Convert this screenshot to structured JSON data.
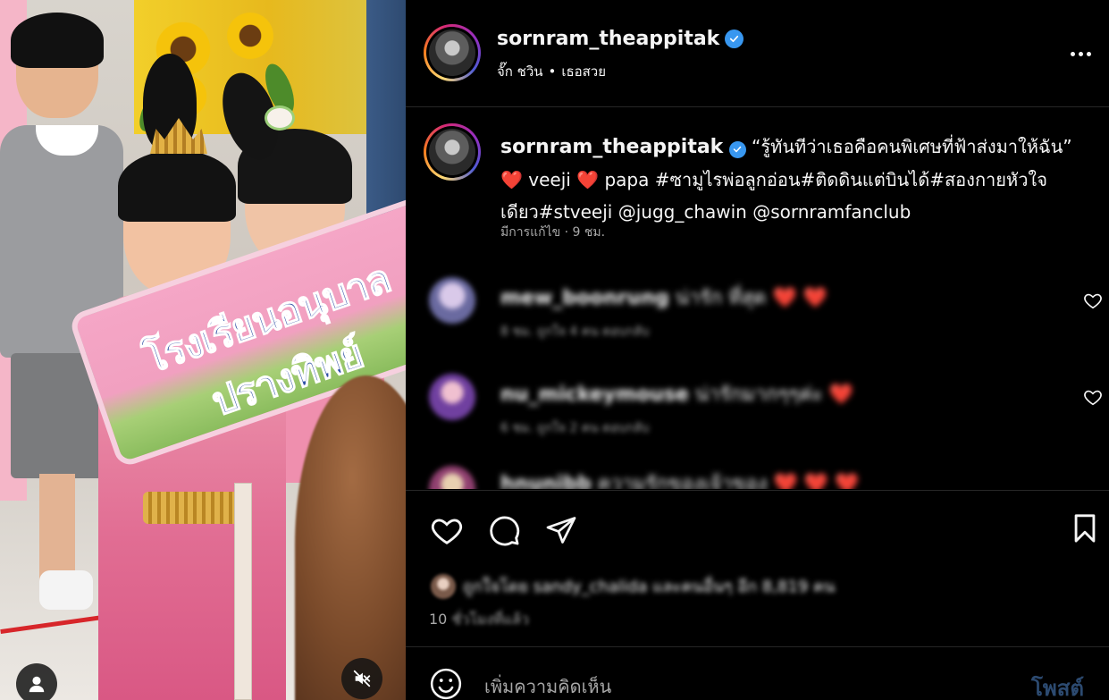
{
  "media": {
    "sign_text": "โรงเรียนอนุบาลปรางทิพย์"
  },
  "post": {
    "username": "sornram_theappitak",
    "audio": {
      "artist": "จั๊ก ชวิน",
      "separator": "•",
      "song": "เธอสวย"
    },
    "caption": {
      "username": "sornram_theappitak",
      "quote": "“รู้ทันทีว่าเธอคือคนพิเศษที่ฟ้าส่งมาให้ฉัน”",
      "heart": "❤️",
      "word1": "veeji",
      "word2": "papa",
      "hashtags": "#ซามูไรพ่อลูกอ่อน#ติดดินแต่บินได้#สองกายหัวใจเดียว#stveeji",
      "mentions": "@jugg_chawin @sornramfanclub",
      "meta": "มีการแก้ไข · 9 ชม."
    },
    "comments": [
      {
        "username": "mew_boonrung",
        "text": "น่ารัก ที่สุด ❤️ ❤️",
        "meta": "8 ชม.    ถูกใจ 4 คน    ตอบกลับ"
      },
      {
        "username": "nu_mickeymouse",
        "text": "น่ารักมากๆๆค่ะ ❤️",
        "meta": "6 ชม.    ถูกใจ 2 คน    ตอบกลับ"
      },
      {
        "username": "hnunibb",
        "text": "ความรักของเจ้าของ ❤️ ❤️ ❤️",
        "meta": ""
      }
    ],
    "likes_text": "ถูกใจโดย sandy_chalida และคนอื่นๆ อีก 8,819 คน",
    "time_prefix": "10",
    "time_rest": "ชั่วโมงที่แล้ว"
  },
  "add_comment": {
    "placeholder": "เพิ่มความคิดเห็น",
    "post_label": "โพสต์"
  },
  "colors": {
    "verified": "#3897f0",
    "heart": "#ff3040",
    "background": "#000000",
    "secondary_text": "#a8a8a8"
  },
  "icons": {
    "header_more": "more-dots-icon",
    "like": "heart-icon",
    "comment": "comment-icon",
    "share": "share-icon",
    "save": "bookmark-icon",
    "emoji": "emoji-icon",
    "mute": "mute-icon",
    "tagged": "user-icon"
  }
}
